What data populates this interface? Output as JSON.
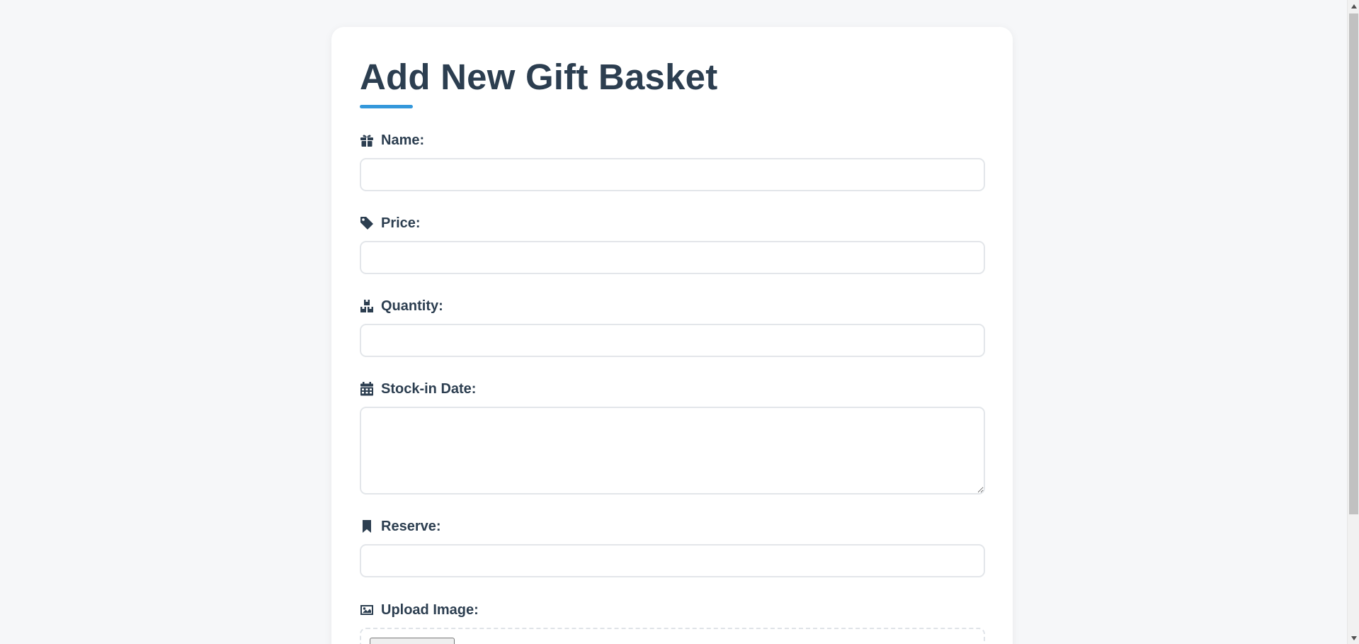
{
  "form": {
    "title": "Add New Gift Basket",
    "fields": [
      {
        "label": "Name:",
        "icon": "gift-icon",
        "value": "",
        "placeholder": ""
      },
      {
        "label": "Price:",
        "icon": "tag-icon",
        "value": "",
        "placeholder": ""
      },
      {
        "label": "Quantity:",
        "icon": "boxes-icon",
        "value": "",
        "placeholder": ""
      },
      {
        "label": "Stock-in Date:",
        "icon": "calendar-icon",
        "value": "",
        "placeholder": ""
      },
      {
        "label": "Reserve:",
        "icon": "bookmark-icon",
        "value": "",
        "placeholder": ""
      },
      {
        "label": "Upload Image:",
        "icon": "image-icon"
      }
    ]
  },
  "colors": {
    "accent": "#3498db",
    "text": "#2c3e50",
    "page_background": "#f6f7f9"
  }
}
